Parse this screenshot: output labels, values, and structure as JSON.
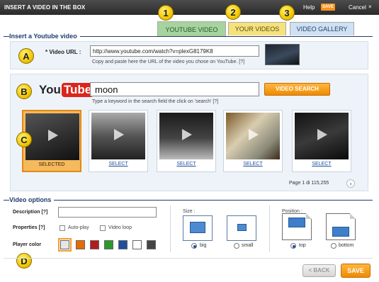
{
  "app": {
    "title": "INSERT A VIDEO IN THE BOX",
    "help": "Help",
    "save": "SAVE",
    "cancel": "Cancel",
    "cancel_icon": "×"
  },
  "tabs": [
    {
      "num": "1",
      "label": "YOUTUBE VIDEO"
    },
    {
      "num": "2",
      "label": "YOUR VIDEOS"
    },
    {
      "num": "3",
      "label": "VIDEO GALLERY"
    }
  ],
  "insert": {
    "heading": "Insert a Youtube video",
    "url_label": "* Video URL :",
    "url_value": "http://www.youtube.com/watch?v=plexG8179K8",
    "url_hint": "Copy and paste here the URL of the video you chose on YouTube. [?]"
  },
  "search": {
    "logo_you": "You",
    "logo_tube": "Tube",
    "value": "moon",
    "button": "VIDEO SEARCH",
    "hint": "Type a keyword in the search field the click on 'search' [?]"
  },
  "results": [
    {
      "caption": "SELECTED",
      "selected": true
    },
    {
      "caption": "SELECT",
      "selected": false
    },
    {
      "caption": "SELECT",
      "selected": false
    },
    {
      "caption": "SELECT",
      "selected": false
    },
    {
      "caption": "SELECT",
      "selected": false
    }
  ],
  "pager": {
    "text": "Page 1 di 115,255",
    "next_icon": "›"
  },
  "markers": {
    "a": "A",
    "b": "B",
    "c": "C",
    "d": "D"
  },
  "options": {
    "heading": "Video options",
    "description_label": "Description [?]",
    "properties_label": "Properties [?]",
    "autoplay_label": "Auto-play",
    "loop_label": "Video loop",
    "player_color_label": "Player color",
    "colors": [
      "#e6e6e6",
      "#e66a00",
      "#b31c1c",
      "#2a9a2a",
      "#1f4f9e",
      "#ffffff",
      "#444444"
    ],
    "size_title": "Size :",
    "size_big": "big",
    "size_small": "small",
    "position_title": "Position :",
    "position_top": "top",
    "position_bottom": "bottom"
  },
  "footer": {
    "back": "< BACK",
    "save": "SAVE"
  }
}
